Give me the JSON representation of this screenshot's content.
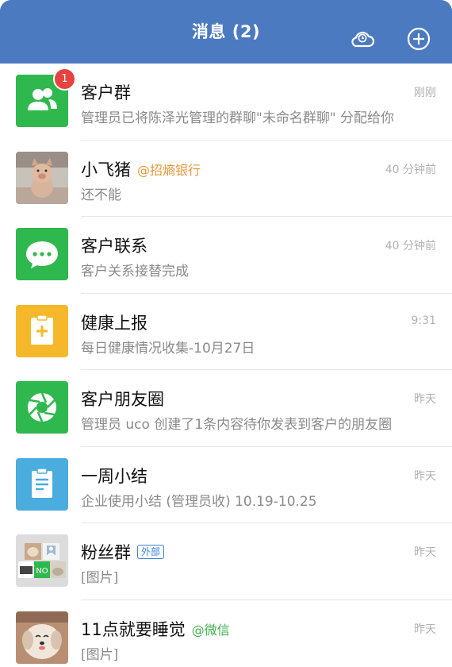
{
  "header": {
    "title": "消息 (2)",
    "icons": [
      "cloud-clock-icon",
      "add-circle-icon"
    ]
  },
  "colors": {
    "header_bg": "#4b7ac0",
    "badge": "#e64340",
    "green_app": "#2fb84e",
    "yellow_app": "#f4b82a",
    "blue_app": "#4bacde"
  },
  "conversations": [
    {
      "name": "客户群",
      "preview": "管理员已将陈泽光管理的群聊\"未命名群聊\" 分配给你",
      "time": "刚刚",
      "badge": "1",
      "icon": "customer-group-icon"
    },
    {
      "name": "小飞猪",
      "tag": "@招熵银行",
      "preview": "还不能",
      "time": "40 分钟前",
      "icon": "pig-photo-avatar"
    },
    {
      "name": "客户联系",
      "preview": "客户关系接替完成",
      "time": "40 分钟前",
      "icon": "chat-bubble-icon"
    },
    {
      "name": "健康上报",
      "preview": "每日健康情况收集-10月27日",
      "time": "9:31",
      "icon": "health-clipboard-icon"
    },
    {
      "name": "客户朋友圈",
      "preview": "管理员 uco 创建了1条内容待你发表到客户的朋友圈",
      "time": "昨天",
      "icon": "aperture-icon"
    },
    {
      "name": "一周小结",
      "preview": "企业使用小结 (管理员收) 10.19-10.25",
      "time": "昨天",
      "icon": "weekly-report-icon"
    },
    {
      "name": "粉丝群",
      "tag": "外部",
      "preview": "[图片]",
      "time": "昨天",
      "icon": "group-collage-avatar"
    },
    {
      "name": "11点就要睡觉",
      "tag": "@微信",
      "preview": "[图片]",
      "time": "昨天",
      "icon": "dog-photo-avatar"
    }
  ]
}
